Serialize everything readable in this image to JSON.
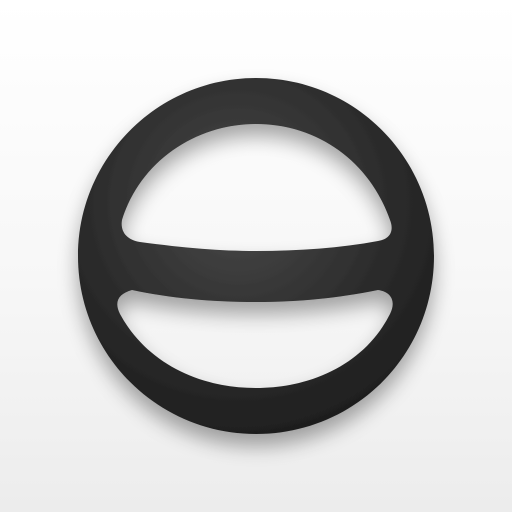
{
  "app_icon": {
    "icon": "steering-wheel-ring-icon",
    "background_color": "#f7f7f7",
    "ring_color": "#2a2a2a",
    "ring_highlight_color": "#4a4a4a"
  }
}
